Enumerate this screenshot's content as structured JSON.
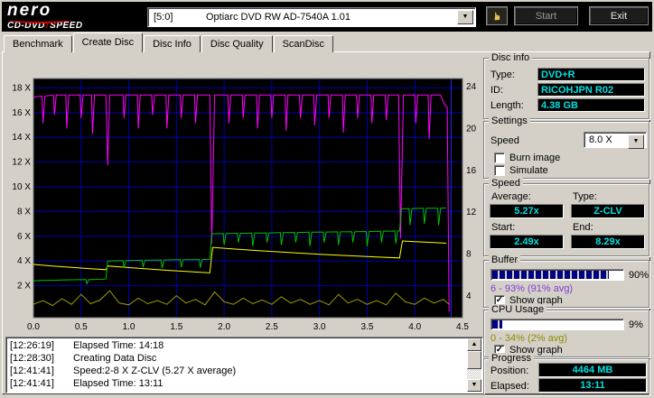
{
  "colors": {
    "value_text": "#00e0e0",
    "buffer_text": "#8040d0",
    "cpu_text": "#8c8c00",
    "progress_fill": "#000082"
  },
  "icons": {
    "up_arrow": "▲",
    "down_arrow": "▼",
    "dropdown_arrow": "▼",
    "check": "✓",
    "hand": "☛"
  },
  "header": {
    "logo_title": "nero",
    "logo_sub_left": "CD-DVD",
    "logo_separator": "/",
    "logo_sub_right": "SPEED",
    "drive_bus": "[5:0]",
    "drive_name": "Optiarc DVD RW AD-7540A 1.01",
    "start_label": "Start",
    "exit_label": "Exit"
  },
  "tabs": [
    {
      "label": "Benchmark",
      "active": false
    },
    {
      "label": "Create Disc",
      "active": true
    },
    {
      "label": "Disc Info",
      "active": false
    },
    {
      "label": "Disc Quality",
      "active": false
    },
    {
      "label": "ScanDisc",
      "active": false
    }
  ],
  "chart_data": {
    "type": "line",
    "title": "",
    "x_axis": {
      "min": 0,
      "max": 4.5,
      "ticks": [
        {
          "v": 0,
          "label": "0.0"
        },
        {
          "v": 0.5,
          "label": "0.5"
        },
        {
          "v": 1,
          "label": "1.0"
        },
        {
          "v": 1.5,
          "label": "1.5"
        },
        {
          "v": 2,
          "label": "2.0"
        },
        {
          "v": 2.5,
          "label": "2.5"
        },
        {
          "v": 3,
          "label": "3.0"
        },
        {
          "v": 3.5,
          "label": "3.5"
        },
        {
          "v": 4,
          "label": "4.0"
        },
        {
          "v": 4.5,
          "label": "4.5"
        }
      ]
    },
    "y_left": {
      "min": 0,
      "max": 18.8,
      "ticks": [
        {
          "v": 2,
          "label": "2 X"
        },
        {
          "v": 4,
          "label": "4 X"
        },
        {
          "v": 6,
          "label": "6 X"
        },
        {
          "v": 8,
          "label": "8 X"
        },
        {
          "v": 10,
          "label": "10 X"
        },
        {
          "v": 12,
          "label": "12 X"
        },
        {
          "v": 14,
          "label": "14 X"
        },
        {
          "v": 16,
          "label": "16 X"
        },
        {
          "v": 18,
          "label": "18 X"
        }
      ]
    },
    "y_right": {
      "min": 0,
      "max": 25,
      "ticks": [
        {
          "v": 4,
          "label": "4"
        },
        {
          "v": 8,
          "label": "8"
        },
        {
          "v": 12,
          "label": "12"
        },
        {
          "v": 16,
          "label": "16"
        },
        {
          "v": 20,
          "label": "20"
        },
        {
          "v": 24,
          "label": "24"
        }
      ]
    },
    "colors": {
      "background": "#000000",
      "grid": "#0000b0",
      "border": "#787878",
      "position_marker": "#2828ff"
    },
    "position_marker_x": 4.38,
    "series": [
      {
        "name": "buffer-level",
        "color": "#ff00ff",
        "axis": "right",
        "points": [
          [
            0,
            23.0
          ],
          [
            0.09,
            23.1
          ],
          [
            0.1,
            20.5
          ],
          [
            0.12,
            23.1
          ],
          [
            0.21,
            23.2
          ],
          [
            0.22,
            21.3
          ],
          [
            0.24,
            23.2
          ],
          [
            0.34,
            23.2
          ],
          [
            0.35,
            20.0
          ],
          [
            0.37,
            23.2
          ],
          [
            0.49,
            23.2
          ],
          [
            0.5,
            21.0
          ],
          [
            0.52,
            23.2
          ],
          [
            0.61,
            23.2
          ],
          [
            0.62,
            19.5
          ],
          [
            0.64,
            23.2
          ],
          [
            0.76,
            23.2
          ],
          [
            0.78,
            16.5
          ],
          [
            0.8,
            23.2
          ],
          [
            0.94,
            23.2
          ],
          [
            0.95,
            21.0
          ],
          [
            0.97,
            23.2
          ],
          [
            1.09,
            23.2
          ],
          [
            1.1,
            20.0
          ],
          [
            1.12,
            23.2
          ],
          [
            1.24,
            23.2
          ],
          [
            1.25,
            21.3
          ],
          [
            1.27,
            23.2
          ],
          [
            1.39,
            23.2
          ],
          [
            1.4,
            20.0
          ],
          [
            1.42,
            23.2
          ],
          [
            1.54,
            23.2
          ],
          [
            1.55,
            21.0
          ],
          [
            1.57,
            23.2
          ],
          [
            1.69,
            23.2
          ],
          [
            1.7,
            20.5
          ],
          [
            1.72,
            23.2
          ],
          [
            1.85,
            23.2
          ],
          [
            1.87,
            9.0
          ],
          [
            1.9,
            23.2
          ],
          [
            2.04,
            23.2
          ],
          [
            2.05,
            20.5
          ],
          [
            2.07,
            23.2
          ],
          [
            2.19,
            23.2
          ],
          [
            2.2,
            21.0
          ],
          [
            2.22,
            23.2
          ],
          [
            2.34,
            23.2
          ],
          [
            2.35,
            20.0
          ],
          [
            2.37,
            23.2
          ],
          [
            2.49,
            23.2
          ],
          [
            2.5,
            21.0
          ],
          [
            2.52,
            23.2
          ],
          [
            2.64,
            23.2
          ],
          [
            2.65,
            19.8
          ],
          [
            2.67,
            23.2
          ],
          [
            2.79,
            23.2
          ],
          [
            2.8,
            21.0
          ],
          [
            2.82,
            23.2
          ],
          [
            2.94,
            23.2
          ],
          [
            2.95,
            20.3
          ],
          [
            2.97,
            23.2
          ],
          [
            3.09,
            23.2
          ],
          [
            3.1,
            21.0
          ],
          [
            3.12,
            23.2
          ],
          [
            3.24,
            23.2
          ],
          [
            3.25,
            19.6
          ],
          [
            3.27,
            23.2
          ],
          [
            3.39,
            23.2
          ],
          [
            3.4,
            21.0
          ],
          [
            3.42,
            23.2
          ],
          [
            3.54,
            23.2
          ],
          [
            3.55,
            20.5
          ],
          [
            3.57,
            23.2
          ],
          [
            3.69,
            23.2
          ],
          [
            3.7,
            20.8
          ],
          [
            3.72,
            23.2
          ],
          [
            3.83,
            23.2
          ],
          [
            3.85,
            9.5
          ],
          [
            3.88,
            23.2
          ],
          [
            4.0,
            23.2
          ],
          [
            4.01,
            20.5
          ],
          [
            4.03,
            23.2
          ],
          [
            4.14,
            23.2
          ],
          [
            4.15,
            19.0
          ],
          [
            4.17,
            23.2
          ],
          [
            4.27,
            23.2
          ],
          [
            4.3,
            22.5
          ],
          [
            4.34,
            22.0
          ],
          [
            4.36,
            2.5
          ]
        ]
      },
      {
        "name": "rotation-speed",
        "color": "#ffff00",
        "axis": "left",
        "points": [
          [
            0,
            3.72
          ],
          [
            0.2,
            3.6
          ],
          [
            0.4,
            3.48
          ],
          [
            0.6,
            3.38
          ],
          [
            0.76,
            3.3
          ],
          [
            0.78,
            3.6
          ],
          [
            1.0,
            3.47
          ],
          [
            1.2,
            3.36
          ],
          [
            1.4,
            3.25
          ],
          [
            1.6,
            3.15
          ],
          [
            1.85,
            3.04
          ],
          [
            1.88,
            5.1
          ],
          [
            2.1,
            4.97
          ],
          [
            2.4,
            4.82
          ],
          [
            2.7,
            4.68
          ],
          [
            3.0,
            4.55
          ],
          [
            3.3,
            4.43
          ],
          [
            3.6,
            4.33
          ],
          [
            3.84,
            4.25
          ],
          [
            3.87,
            5.62
          ],
          [
            4.0,
            5.57
          ],
          [
            4.2,
            5.5
          ],
          [
            4.33,
            5.44
          ]
        ]
      },
      {
        "name": "cpu-usage",
        "color": "#9c9c00",
        "axis": "left",
        "points": [
          [
            0,
            0.5
          ],
          [
            0.1,
            0.8
          ],
          [
            0.2,
            0.4
          ],
          [
            0.3,
            0.95
          ],
          [
            0.4,
            0.5
          ],
          [
            0.5,
            1.3
          ],
          [
            0.6,
            0.55
          ],
          [
            0.7,
            0.85
          ],
          [
            0.8,
            1.6
          ],
          [
            0.9,
            0.6
          ],
          [
            1.0,
            0.45
          ],
          [
            1.1,
            1.0
          ],
          [
            1.2,
            0.55
          ],
          [
            1.3,
            0.8
          ],
          [
            1.4,
            0.5
          ],
          [
            1.5,
            1.2
          ],
          [
            1.6,
            0.6
          ],
          [
            1.7,
            0.9
          ],
          [
            1.8,
            0.45
          ],
          [
            1.9,
            1.5
          ],
          [
            2.0,
            0.7
          ],
          [
            2.1,
            0.5
          ],
          [
            2.2,
            1.0
          ],
          [
            2.3,
            0.55
          ],
          [
            2.4,
            0.85
          ],
          [
            2.5,
            0.5
          ],
          [
            2.6,
            1.1
          ],
          [
            2.7,
            0.6
          ],
          [
            2.8,
            0.9
          ],
          [
            2.9,
            0.5
          ],
          [
            3.0,
            0.8
          ],
          [
            3.1,
            0.45
          ],
          [
            3.2,
            1.3
          ],
          [
            3.3,
            0.6
          ],
          [
            3.4,
            0.9
          ],
          [
            3.5,
            0.5
          ],
          [
            3.6,
            0.8
          ],
          [
            3.7,
            0.45
          ],
          [
            3.8,
            1.4
          ],
          [
            3.9,
            0.7
          ],
          [
            4.0,
            0.5
          ],
          [
            4.1,
            1.0
          ],
          [
            4.2,
            0.6
          ],
          [
            4.3,
            0.9
          ],
          [
            4.36,
            0.5
          ]
        ]
      },
      {
        "name": "write-speed",
        "color": "#00c000",
        "axis": "left",
        "points": [
          [
            0,
            2.4
          ],
          [
            0.1,
            2.42
          ],
          [
            0.2,
            2.44
          ],
          [
            0.3,
            2.46
          ],
          [
            0.4,
            2.48
          ],
          [
            0.55,
            2.5
          ],
          [
            0.56,
            2.15
          ],
          [
            0.58,
            2.5
          ],
          [
            0.7,
            2.52
          ],
          [
            0.76,
            2.54
          ],
          [
            0.78,
            4.0
          ],
          [
            0.94,
            4.03
          ],
          [
            0.95,
            3.45
          ],
          [
            0.97,
            4.03
          ],
          [
            1.14,
            4.06
          ],
          [
            1.15,
            3.5
          ],
          [
            1.17,
            4.06
          ],
          [
            1.34,
            4.08
          ],
          [
            1.35,
            3.42
          ],
          [
            1.37,
            4.08
          ],
          [
            1.54,
            4.1
          ],
          [
            1.55,
            3.5
          ],
          [
            1.57,
            4.1
          ],
          [
            1.74,
            4.12
          ],
          [
            1.75,
            3.45
          ],
          [
            1.77,
            4.12
          ],
          [
            1.85,
            4.14
          ],
          [
            1.87,
            6.2
          ],
          [
            1.99,
            6.22
          ],
          [
            2.0,
            5.3
          ],
          [
            2.02,
            6.22
          ],
          [
            2.14,
            6.24
          ],
          [
            2.15,
            5.5
          ],
          [
            2.17,
            6.24
          ],
          [
            2.29,
            6.26
          ],
          [
            2.3,
            5.2
          ],
          [
            2.32,
            6.26
          ],
          [
            2.44,
            6.27
          ],
          [
            2.45,
            5.5
          ],
          [
            2.47,
            6.27
          ],
          [
            2.59,
            6.29
          ],
          [
            2.6,
            5.3
          ],
          [
            2.62,
            6.29
          ],
          [
            2.74,
            6.31
          ],
          [
            2.75,
            5.5
          ],
          [
            2.77,
            6.31
          ],
          [
            2.89,
            6.33
          ],
          [
            2.9,
            5.2
          ],
          [
            2.92,
            6.33
          ],
          [
            3.04,
            6.34
          ],
          [
            3.05,
            5.5
          ],
          [
            3.07,
            6.34
          ],
          [
            3.19,
            6.36
          ],
          [
            3.2,
            5.3
          ],
          [
            3.22,
            6.36
          ],
          [
            3.34,
            6.37
          ],
          [
            3.35,
            5.5
          ],
          [
            3.37,
            6.37
          ],
          [
            3.49,
            6.39
          ],
          [
            3.5,
            5.2
          ],
          [
            3.52,
            6.39
          ],
          [
            3.64,
            6.4
          ],
          [
            3.65,
            5.5
          ],
          [
            3.67,
            6.4
          ],
          [
            3.79,
            6.42
          ],
          [
            3.8,
            5.4
          ],
          [
            3.82,
            6.42
          ],
          [
            3.84,
            6.43
          ],
          [
            3.86,
            8.22
          ],
          [
            3.94,
            8.24
          ],
          [
            3.95,
            6.9
          ],
          [
            3.97,
            8.24
          ],
          [
            4.09,
            8.26
          ],
          [
            4.1,
            7.0
          ],
          [
            4.12,
            8.26
          ],
          [
            4.24,
            8.27
          ],
          [
            4.25,
            6.9
          ],
          [
            4.27,
            8.27
          ],
          [
            4.33,
            8.29
          ]
        ]
      }
    ]
  },
  "panel": {
    "disc_info": {
      "title": "Disc info",
      "rows": [
        {
          "label": "Type:",
          "value": "DVD+R"
        },
        {
          "label": "ID:",
          "value": "RICOHJPN R02"
        },
        {
          "label": "Length:",
          "value": "4.38 GB"
        }
      ]
    },
    "settings": {
      "title": "Settings",
      "speed_label": "Speed",
      "speed_value": "8.0 X",
      "checkboxes": [
        {
          "label": "Burn image",
          "checked": false
        },
        {
          "label": "Simulate",
          "checked": false
        }
      ]
    },
    "speed": {
      "title": "Speed",
      "average_label": "Average:",
      "average_value": "5.27x",
      "type_label": "Type:",
      "type_value": "Z-CLV",
      "start_label": "Start:",
      "start_value": "2.49x",
      "end_label": "End:",
      "end_value": "8.29x"
    },
    "buffer": {
      "title": "Buffer",
      "fill": 90,
      "percent_label": "90%",
      "range_text": "6 - 93% (91% avg)",
      "show_graph_label": "Show graph",
      "show_graph_checked": true
    },
    "cpu": {
      "title": "CPU Usage",
      "fill": 9,
      "percent_label": "9%",
      "range_text": "0 - 34% (2% avg)",
      "show_graph_label": "Show graph",
      "show_graph_checked": true
    },
    "progress": {
      "title": "Progress",
      "position_label": "Position:",
      "position_value": "4464 MB",
      "elapsed_label": "Elapsed:",
      "elapsed_value": "13:11"
    }
  },
  "log": {
    "entries": [
      {
        "time": "[12:26:19]",
        "text": "Elapsed Time: 14:18"
      },
      {
        "time": "[12:28:30]",
        "text": "Creating Data Disc"
      },
      {
        "time": "[12:41:41]",
        "text": "Speed:2-8 X Z-CLV (5.27 X average)"
      },
      {
        "time": "[12:41:41]",
        "text": "Elapsed Time: 13:11"
      }
    ]
  }
}
